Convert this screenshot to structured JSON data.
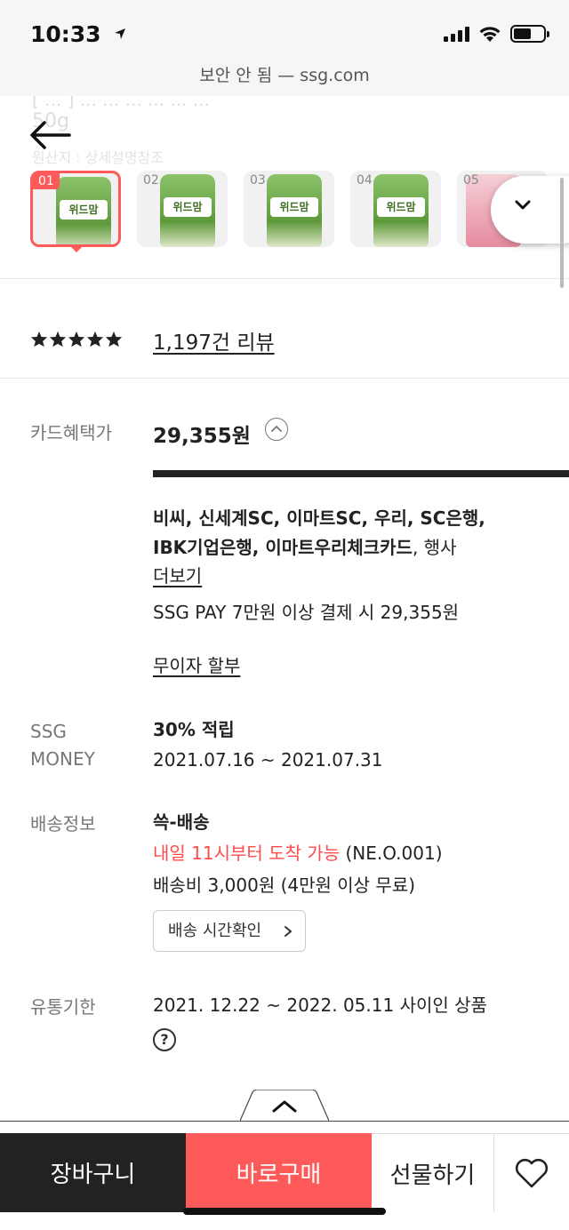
{
  "status_bar": {
    "time": "10:33",
    "url": "보안 안 됨 — ssg.com"
  },
  "header": {
    "ghost_text_1": "[ ... ] ... ... ... ... ... ...",
    "ghost_text_2": "50g",
    "ghost_text_3": "원산지 : 상세설명참조"
  },
  "thumbnails": [
    {
      "num": "01",
      "label": "위드맘",
      "active": true
    },
    {
      "num": "02",
      "label": "위드맘",
      "active": false
    },
    {
      "num": "03",
      "label": "위드맘",
      "active": false
    },
    {
      "num": "04",
      "label": "위드맘",
      "active": false
    },
    {
      "num": "05",
      "label": "",
      "active": false
    }
  ],
  "review": {
    "rating_stars": 5,
    "link_text": "1,197건 리뷰"
  },
  "card_benefit": {
    "label": "카드혜택가",
    "price": "29,355원",
    "cards_line1": "비씨, 신세계SC, 이마트SC, 우리, SC은행,",
    "cards_line2_bold": "IBK기업은행, 이마트우리체크카드",
    "cards_line2_rest": ", 행사",
    "more_link": "더보기",
    "ssgpay_line": "SSG PAY 7만원 이상 결제 시 29,355원",
    "installment_link": "무이자 할부"
  },
  "ssg_money": {
    "label_line1": "SSG",
    "label_line2": "MONEY",
    "title": "30% 적립",
    "period": "2021.07.16 ~ 2021.07.31"
  },
  "delivery": {
    "label": "배송정보",
    "title": "쓱-배송",
    "arrival_red": "내일 11시부터 도착 가능",
    "arrival_code": " (NE.O.001)",
    "fee": "배송비 3,000원 (4만원 이상 무료)",
    "check_button": "배송 시간확인"
  },
  "expiry": {
    "label": "유통기한",
    "value": "2021. 12.22 ~ 2022. 05.11 사이인 상품",
    "help_icon_text": "?"
  },
  "bottom_bar": {
    "cart": "장바구니",
    "buy": "바로구매",
    "gift": "선물하기"
  },
  "colors": {
    "accent": "#ff5a5a",
    "dark": "#222222",
    "red_text": "#ff4b4b"
  }
}
